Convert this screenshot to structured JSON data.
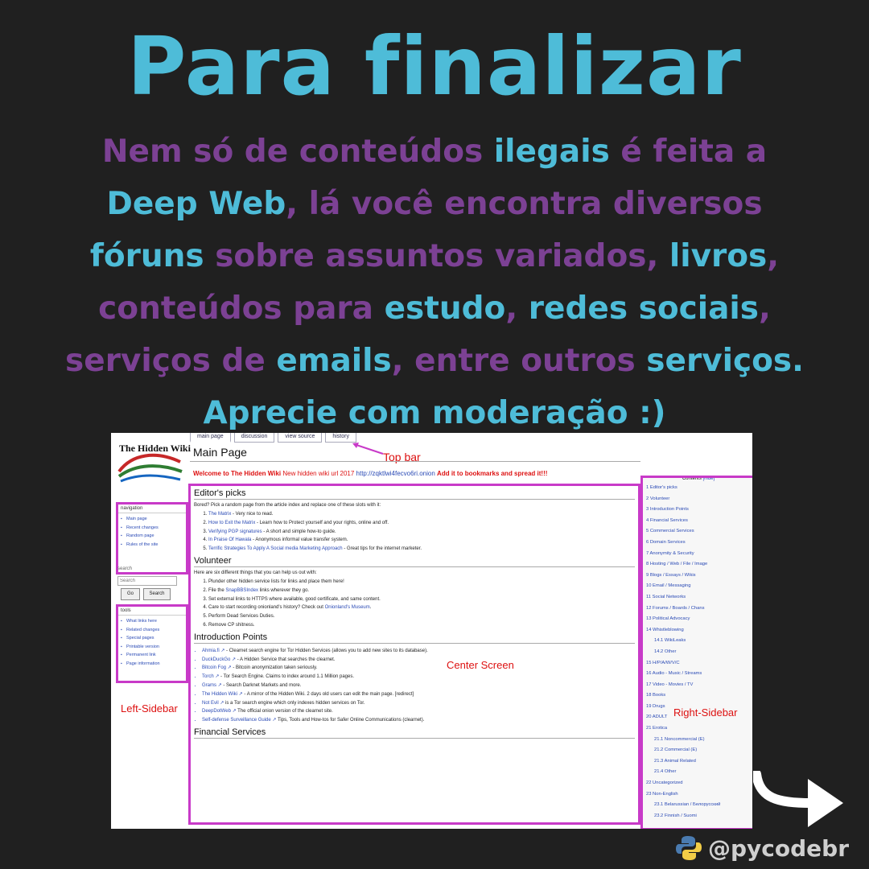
{
  "header": {
    "title": "Para finalizar"
  },
  "body_lines": [
    [
      {
        "t": "Nem só de conteúdos ",
        "c": "purple"
      },
      {
        "t": "ilegais",
        "c": "cyan"
      },
      {
        "t": " é feita a",
        "c": "purple"
      }
    ],
    [
      {
        "t": "Deep Web",
        "c": "cyan"
      },
      {
        "t": ", lá você encontra diversos",
        "c": "purple"
      }
    ],
    [
      {
        "t": "fóruns",
        "c": "cyan"
      },
      {
        "t": " sobre assuntos variados, ",
        "c": "purple"
      },
      {
        "t": "livros",
        "c": "cyan"
      },
      {
        "t": ",",
        "c": "purple"
      }
    ],
    [
      {
        "t": "conteúdos para ",
        "c": "purple"
      },
      {
        "t": "estudo",
        "c": "cyan"
      },
      {
        "t": ", ",
        "c": "purple"
      },
      {
        "t": "redes sociais",
        "c": "cyan"
      },
      {
        "t": ",",
        "c": "purple"
      }
    ],
    [
      {
        "t": "serviços de ",
        "c": "purple"
      },
      {
        "t": "emails",
        "c": "cyan"
      },
      {
        "t": ", entre outros ",
        "c": "purple"
      },
      {
        "t": "serviços.",
        "c": "cyan"
      }
    ],
    [
      {
        "t": "Aprecie com moderação :)",
        "c": "cyan"
      }
    ]
  ],
  "colors": {
    "purple": "#7c4194",
    "cyan": "#4ebcd8",
    "annotation_box": "#c83ac8",
    "annotation_text": "#dd1111"
  },
  "wiki": {
    "logo": "The Hidden Wiki",
    "tabs": [
      "main page",
      "discussion",
      "view source",
      "history"
    ],
    "page_title": "Main Page",
    "welcome_prefix": "Welcome to The Hidden Wiki",
    "welcome_mid": "New hidden wiki url 2017",
    "welcome_url": "http://zqktlwi4fecvo6ri.onion",
    "welcome_suffix": "Add it to bookmarks and spread it!!!",
    "annotations": {
      "top_bar": "Top bar",
      "left_sidebar": "Left-Sidebar",
      "center_screen": "Center Screen",
      "right_sidebar": "Right-Sidebar"
    },
    "navigation": {
      "heading": "navigation",
      "items": [
        "Main page",
        "Recent changes",
        "Random page",
        "Rules of the site"
      ]
    },
    "search": {
      "heading": "search",
      "placeholder": "Search",
      "go": "Go",
      "search": "Search"
    },
    "tools": {
      "heading": "tools",
      "items": [
        "What links here",
        "Related changes",
        "Special pages",
        "Printable version",
        "Permanent link",
        "Page information"
      ]
    },
    "editors_picks": {
      "heading": "Editor's picks",
      "intro": "Bored? Pick a random page from the article index and replace one of these slots with it:",
      "items": [
        {
          "link": "The Matrix",
          "text": " - Very nice to read."
        },
        {
          "link": "How to Exit the Matrix",
          "text": " - Learn how to Protect yourself and your rights, online and off."
        },
        {
          "link": "Verifying PGP signatures",
          "text": " - A short and simple how-to guide."
        },
        {
          "link": "In Praise Of Hawala",
          "text": " - Anonymous informal value transfer system."
        },
        {
          "link": "Terrific Strategies To Apply A Social media Marketing Approach",
          "text": " - Great tips for the internet marketer."
        }
      ]
    },
    "volunteer": {
      "heading": "Volunteer",
      "intro": "Here are six different things that you can help us out with:",
      "items": [
        {
          "pre": "Plunder other hidden service lists for links and place them here!",
          "link": "",
          "post": ""
        },
        {
          "pre": "File the ",
          "link": "SnapBBSIndex",
          "post": " links wherever they go."
        },
        {
          "pre": "Set external links to HTTPS where available, good certificate, and same content.",
          "link": "",
          "post": ""
        },
        {
          "pre": "Care to start recording onionland's history? Check out ",
          "link": "Onionland's Museum",
          "post": "."
        },
        {
          "pre": "Perform Dead Services Duties.",
          "link": "",
          "post": ""
        },
        {
          "pre": "Remove CP shitness.",
          "link": "",
          "post": ""
        }
      ]
    },
    "intro_points": {
      "heading": "Introduction Points",
      "items": [
        {
          "link": "Ahmia.fi",
          "text": " - Clearnet search engine for Tor Hidden Services (allows you to add new sites to its database)."
        },
        {
          "link": "DuckDuckGo",
          "text": " - A Hidden Service that searches the clearnet."
        },
        {
          "link": "Bitcoin Fog",
          "text": " - Bitcoin anonymization taken seriously."
        },
        {
          "link": "Torch",
          "text": " - Tor Search Engine. Claims to index around 1.1 Million pages."
        },
        {
          "link": "Grams",
          "text": " - Search Darknet Markets and more."
        },
        {
          "link": "The Hidden Wiki",
          "text": " - A mirror of the Hidden Wiki. 2 days old users can edit the main page. [redirect]"
        },
        {
          "link": "Not Evil",
          "text": " is a Tor search engine which only indexes hidden services on Tor."
        },
        {
          "link": "DeepDotWeb",
          "text": " The official onion version of the clearnet site."
        },
        {
          "link": "Self-defense Surveillance Guide",
          "text": " Tips, Tools and How-tos for Safer Online Communications (clearnet)."
        }
      ]
    },
    "next_heading": "Financial Services",
    "contents": {
      "heading": "Contents",
      "hide": "[hide]",
      "items": [
        {
          "t": "1 Editor's picks",
          "sub": false
        },
        {
          "t": "2 Volunteer",
          "sub": false
        },
        {
          "t": "3 Introduction Points",
          "sub": false
        },
        {
          "t": "4 Financial Services",
          "sub": false
        },
        {
          "t": "5 Commercial Services",
          "sub": false
        },
        {
          "t": "6 Domain Services",
          "sub": false
        },
        {
          "t": "7 Anonymity & Security",
          "sub": false
        },
        {
          "t": "8 Hosting / Web / File / Image",
          "sub": false
        },
        {
          "t": "9 Blogs / Essays / Wikis",
          "sub": false
        },
        {
          "t": "10 Email / Messaging",
          "sub": false
        },
        {
          "t": "11 Social Networks",
          "sub": false
        },
        {
          "t": "12 Forums / Boards / Chans",
          "sub": false
        },
        {
          "t": "13 Political Advocacy",
          "sub": false
        },
        {
          "t": "14 Whistleblowing",
          "sub": false
        },
        {
          "t": "14.1 WikiLeaks",
          "sub": true
        },
        {
          "t": "14.2 Other",
          "sub": true
        },
        {
          "t": "15 H/P/A/W/V/C",
          "sub": false
        },
        {
          "t": "16 Audio - Music / Streams",
          "sub": false
        },
        {
          "t": "17 Video - Movies / TV",
          "sub": false
        },
        {
          "t": "18 Books",
          "sub": false
        },
        {
          "t": "19 Drugs",
          "sub": false
        },
        {
          "t": "20 ADULT",
          "sub": false
        },
        {
          "t": "21 Erotica",
          "sub": false
        },
        {
          "t": "21.1 Noncommercial (E)",
          "sub": true
        },
        {
          "t": "21.2 Commercial (E)",
          "sub": true
        },
        {
          "t": "21.3 Animal Related",
          "sub": true
        },
        {
          "t": "21.4 Other",
          "sub": true
        },
        {
          "t": "22 Uncategorized",
          "sub": false
        },
        {
          "t": "23 Non-English",
          "sub": false
        },
        {
          "t": "23.1 Belarussian / Белорусский",
          "sub": true
        },
        {
          "t": "23.2 Finnish / Suomi",
          "sub": true
        }
      ]
    }
  },
  "watermark": {
    "handle": "@pycodebr",
    "icon": "python-logo-icon"
  },
  "next_icon": "arrow-right-icon"
}
